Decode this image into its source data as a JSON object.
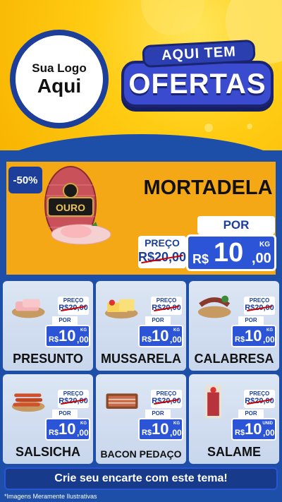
{
  "logo": {
    "line1": "Sua Logo",
    "line2": "Aqui"
  },
  "banner": {
    "top": "AQUI TEM",
    "main": "OFERTAS"
  },
  "feature": {
    "discount": "-50%",
    "brand_label": "OURO",
    "name": "MORTADELA",
    "preco_label": "PREÇO",
    "old_price": "R$20,00",
    "por_label": "POR",
    "currency": "R$",
    "price_int": "10",
    "price_dec": ",00",
    "unit": "KG"
  },
  "products": [
    {
      "name": "PRESUNTO",
      "preco_label": "PREÇO",
      "old_price": "R$20,00",
      "por_label": "POR",
      "currency": "R$",
      "price_int": "10",
      "price_dec": ",00",
      "unit": "KG"
    },
    {
      "name": "MUSSARELA",
      "preco_label": "PREÇO",
      "old_price": "R$20,00",
      "por_label": "POR",
      "currency": "R$",
      "price_int": "10",
      "price_dec": ",00",
      "unit": "KG"
    },
    {
      "name": "CALABRESA",
      "preco_label": "PREÇO",
      "old_price": "R$20,00",
      "por_label": "POR",
      "currency": "R$",
      "price_int": "10",
      "price_dec": ",00",
      "unit": "KG"
    },
    {
      "name": "SALSICHA",
      "preco_label": "PREÇO",
      "old_price": "R$20,00",
      "por_label": "POR",
      "currency": "R$",
      "price_int": "10",
      "price_dec": ",00",
      "unit": "KG"
    },
    {
      "name": "BACON PEDAÇO",
      "preco_label": "PREÇO",
      "old_price": "R$20,00",
      "por_label": "POR",
      "currency": "R$",
      "price_int": "10",
      "price_dec": ",00",
      "unit": "KG"
    },
    {
      "name": "SALAME",
      "preco_label": "PREÇO",
      "old_price": "R$20,00",
      "por_label": "POR",
      "currency": "R$",
      "price_int": "10",
      "price_dec": ",00",
      "unit": "UNID"
    }
  ],
  "cta": "Crie seu encarte com este tema!",
  "footnote": "*Imagens Meramente Ilustrativas"
}
